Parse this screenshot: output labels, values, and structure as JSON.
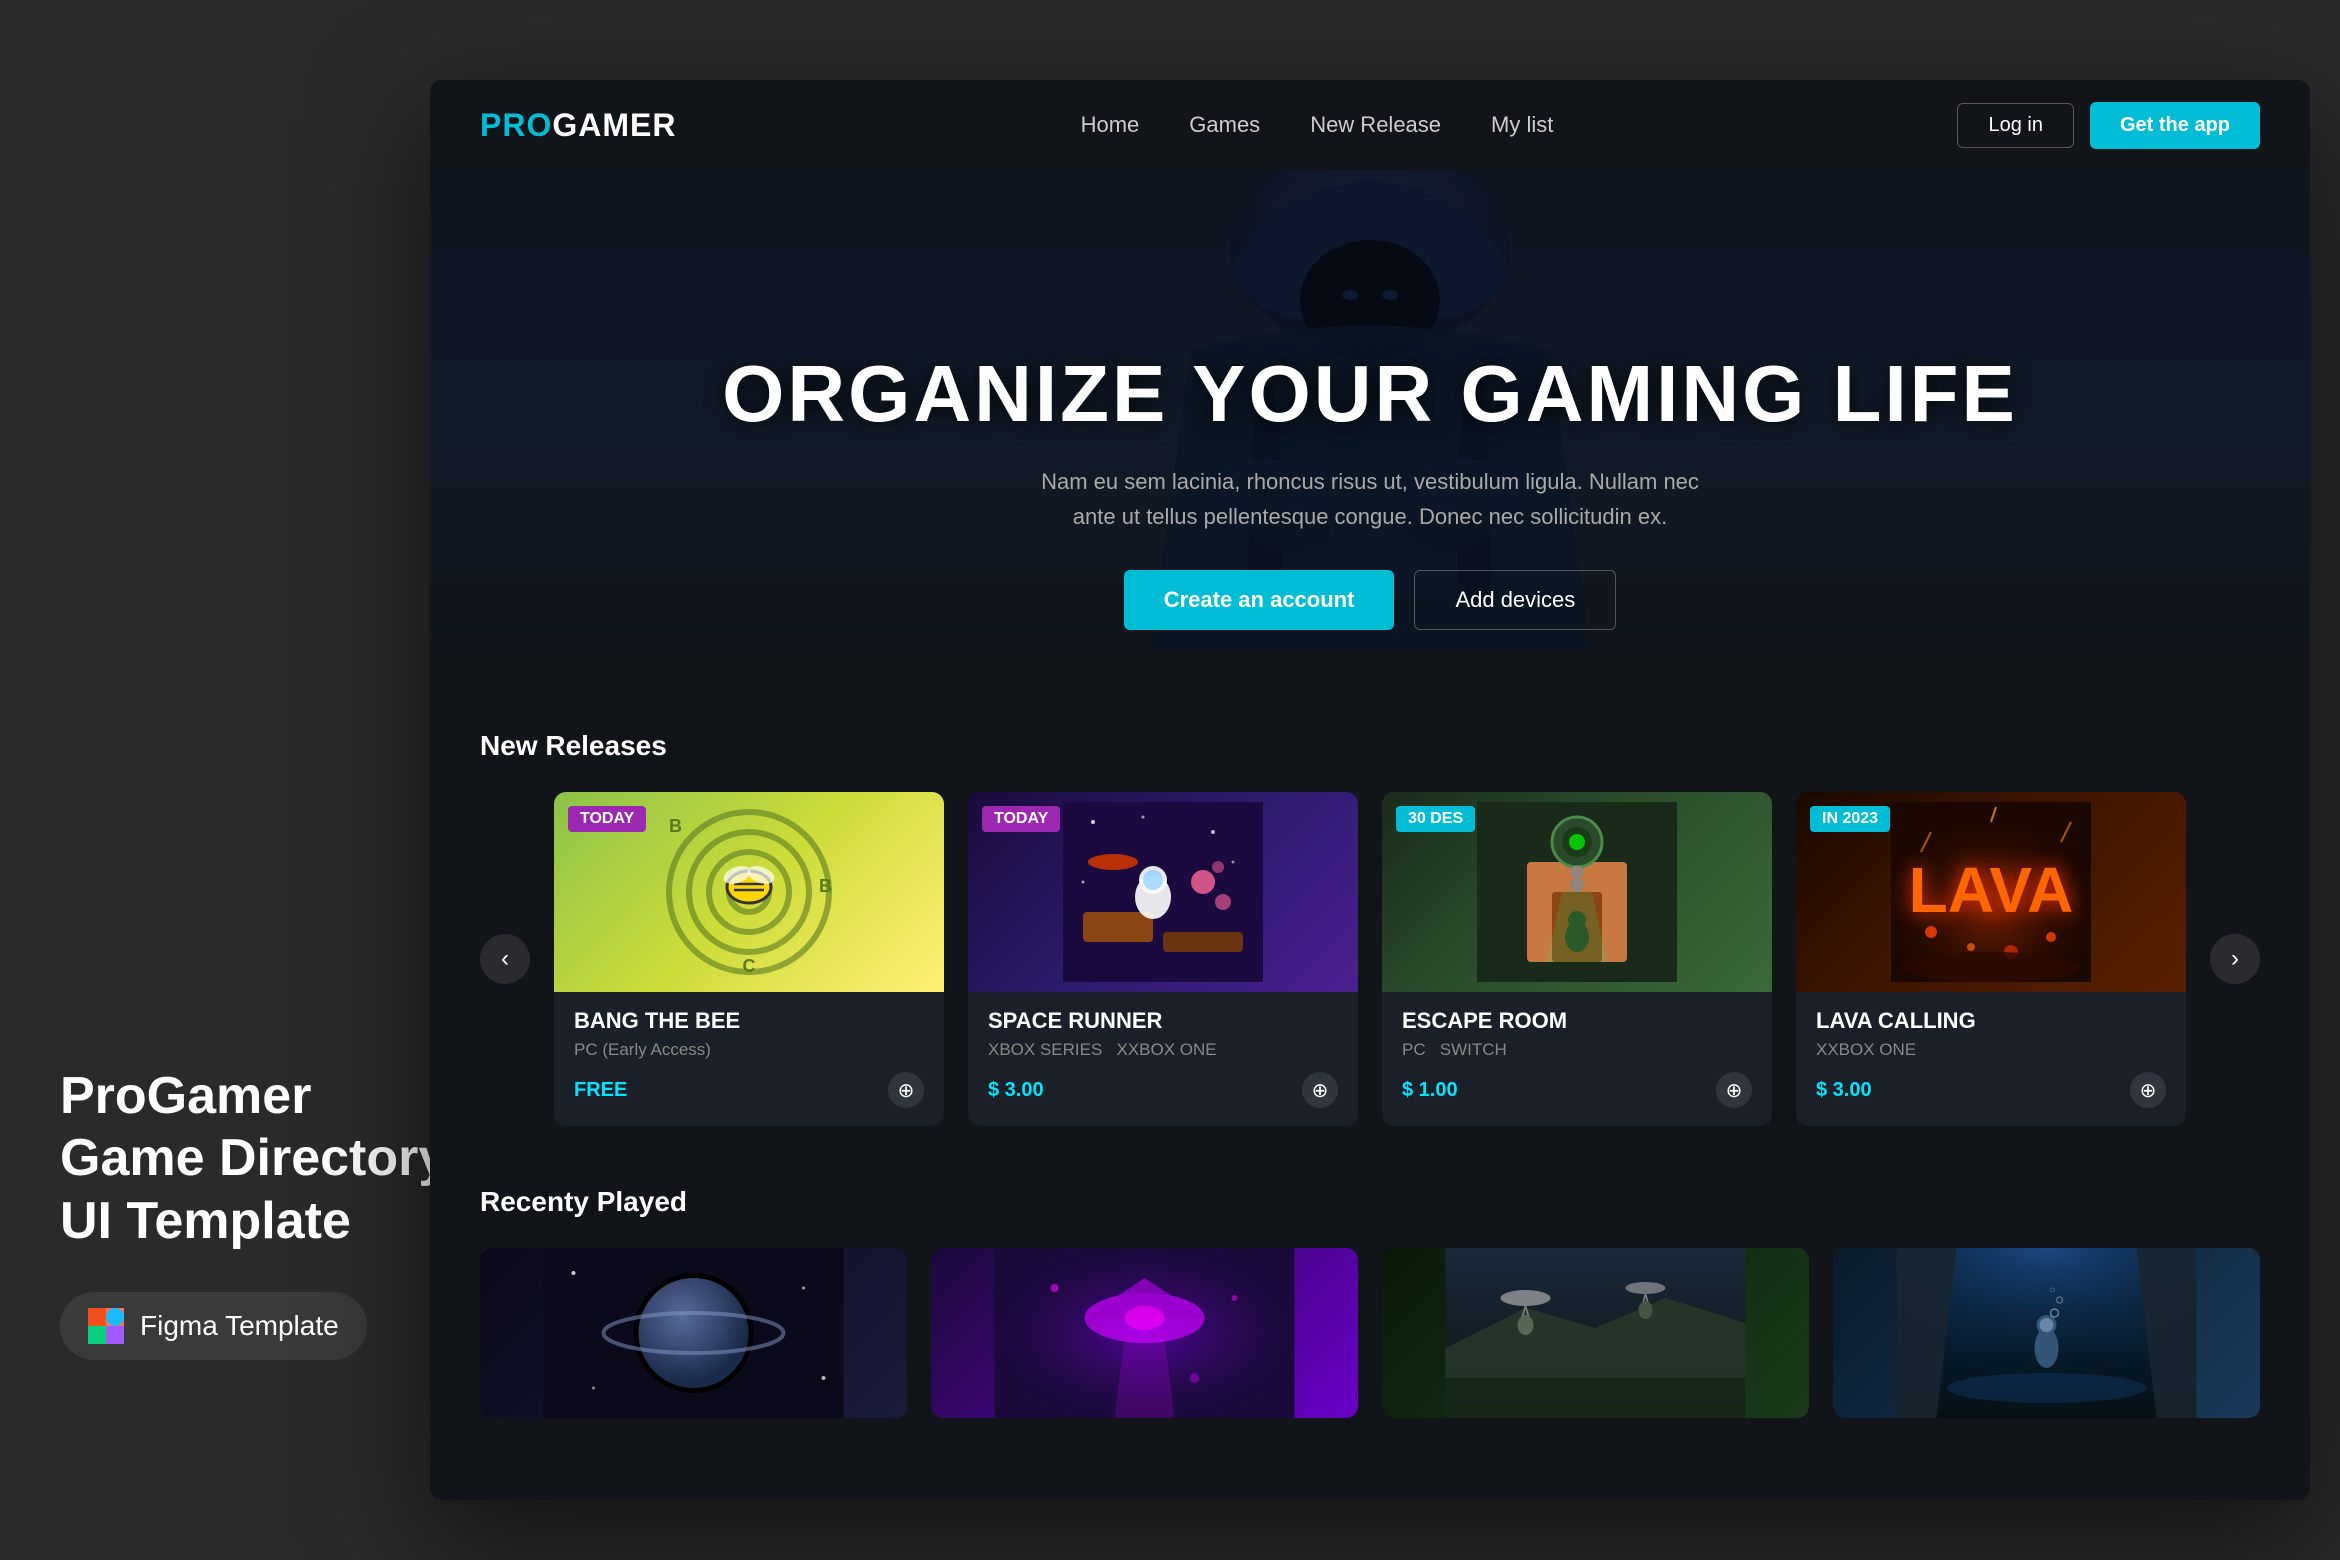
{
  "left_panel": {
    "title_line1": "ProGamer",
    "title_line2": "Game Directory",
    "title_line3": "UI Template",
    "figma_label": "Figma Template"
  },
  "navbar": {
    "logo_pro": "PRO",
    "logo_gamer": "GAMER",
    "nav_items": [
      {
        "label": "Home",
        "href": "#"
      },
      {
        "label": "Games",
        "href": "#"
      },
      {
        "label": "New Release",
        "href": "#"
      },
      {
        "label": "My list",
        "href": "#"
      }
    ],
    "login_label": "Log in",
    "getapp_label": "Get the app"
  },
  "hero": {
    "title": "ORGANIZE YOUR GAMING LIFE",
    "subtitle": "Nam eu sem lacinia, rhoncus risus ut, vestibulum ligula. Nullam nec ante ut tellus pellentesque congue. Donec nec sollicitudin ex.",
    "cta_primary": "Create an account",
    "cta_secondary": "Add devices"
  },
  "new_releases": {
    "section_title": "New Releases",
    "carousel_prev": "‹",
    "carousel_next": "›",
    "games": [
      {
        "badge": "TODAY",
        "badge_type": "today",
        "name": "BANG THE BEE",
        "platform": "PC (Early Access)",
        "price": "FREE",
        "price_type": "free"
      },
      {
        "badge": "TODAY",
        "badge_type": "today",
        "name": "SPACE RUNNER",
        "platform": "XBOX SERIES   XXBOX ONE",
        "price": "$ 3.00",
        "price_type": "paid"
      },
      {
        "badge": "30 DES",
        "badge_type": "date",
        "name": "ESCAPE ROOM",
        "platform": "PC   SWITCH",
        "price": "$ 1.00",
        "price_type": "paid"
      },
      {
        "badge": "IN 2023",
        "badge_type": "year",
        "name": "LAVA CALLING",
        "platform": "XXBOX ONE",
        "price": "$ 3.00",
        "price_type": "paid"
      }
    ]
  },
  "recently_played": {
    "section_title": "Recenty Played"
  }
}
